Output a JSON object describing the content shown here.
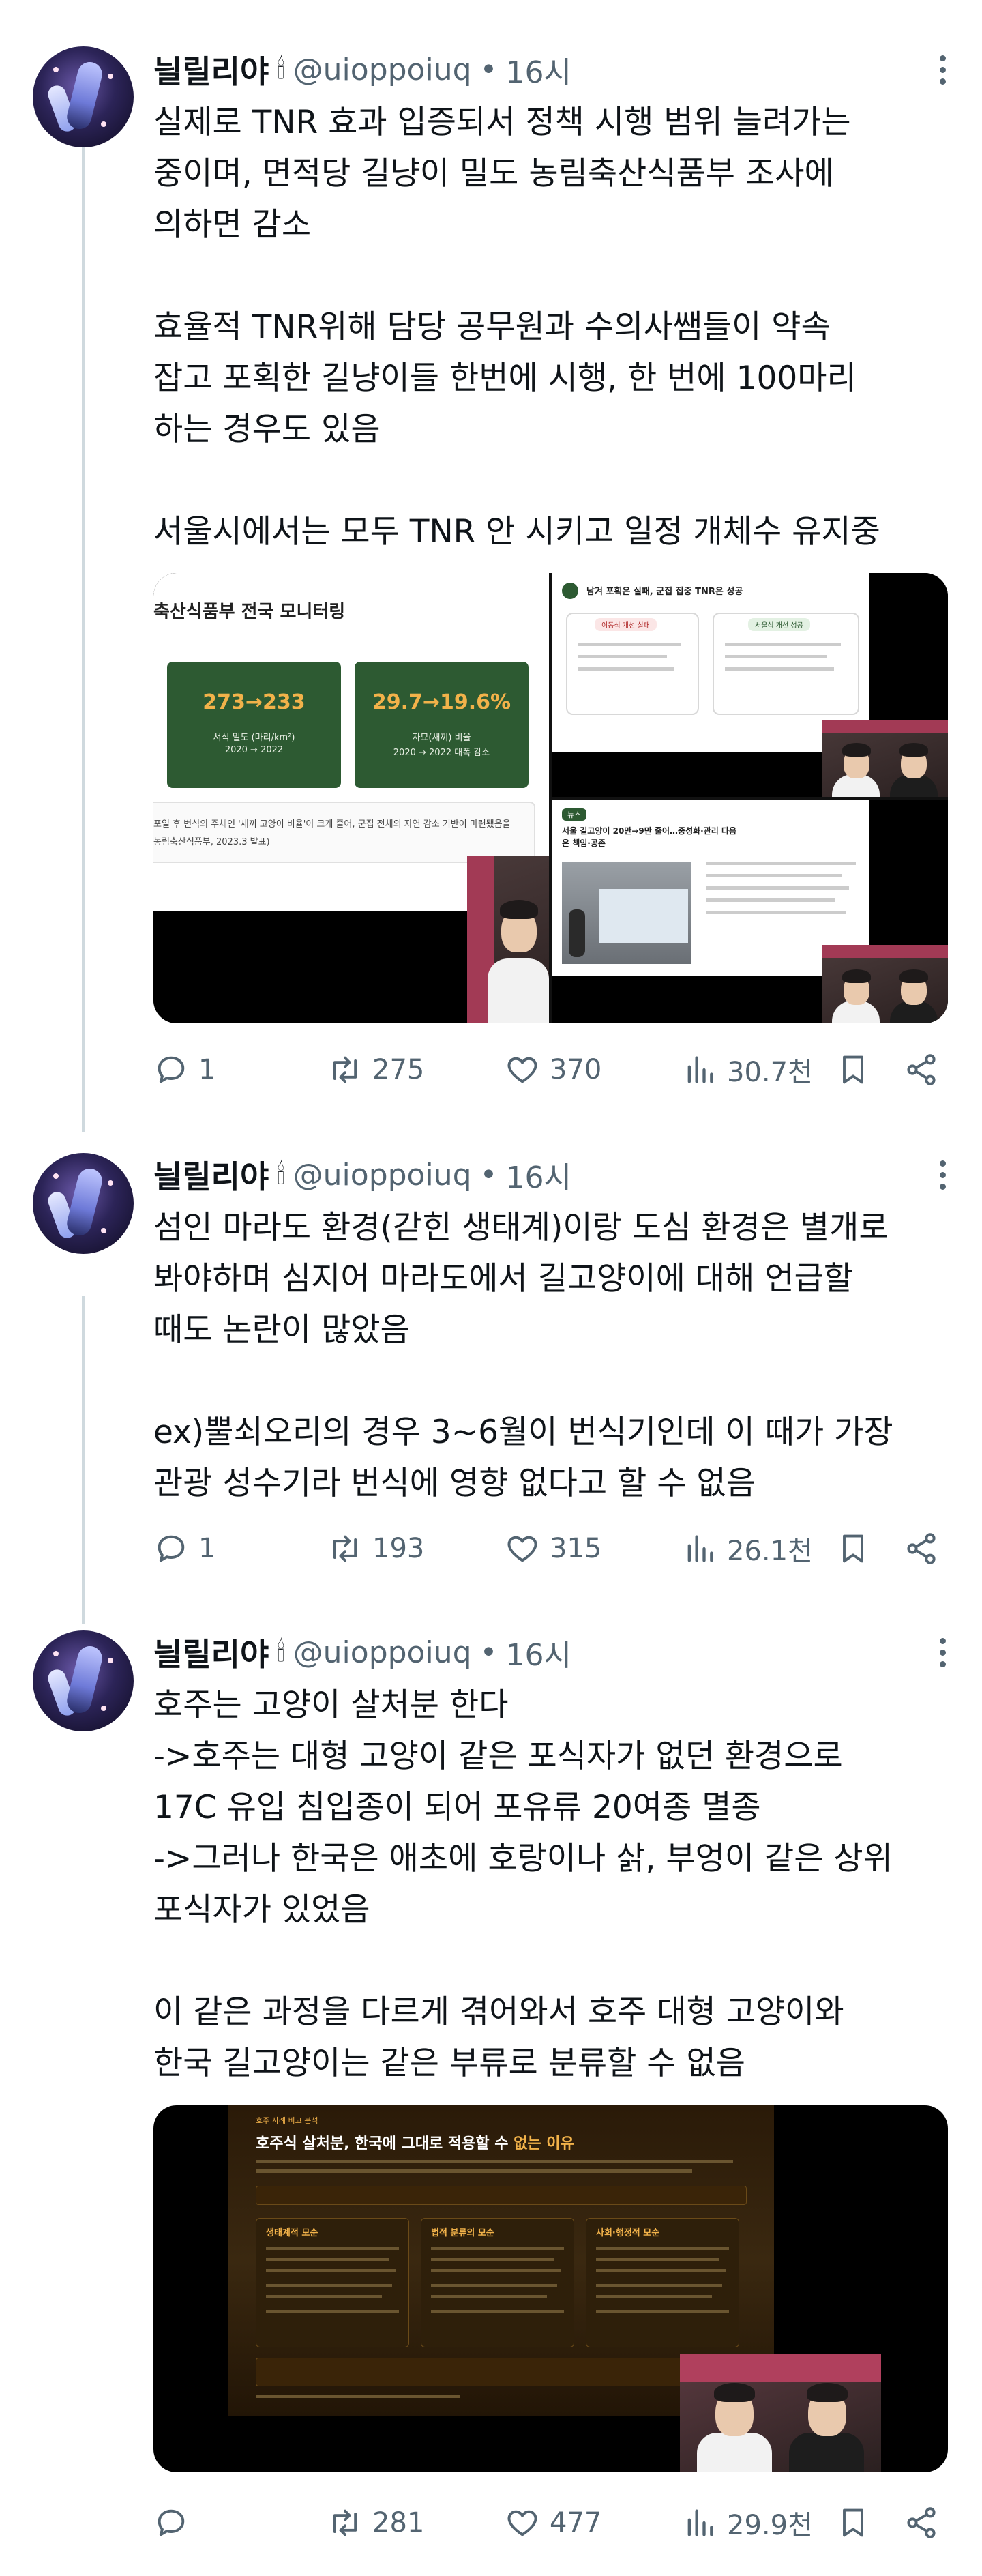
{
  "tweets": [
    {
      "name": "늴릴리야",
      "handle": "@uioppoiuq",
      "dot": "•",
      "time": "16시",
      "lines": [
        "실제로 TNR 효과 입증되서 정책 시행 범위 늘려가는",
        "중이며, 면적당 길냥이 밀도 농림축산식품부 조사에",
        "의하면 감소",
        "",
        "효율적 TNR위해 담당 공무원과 수의사쌤들이 약속",
        "잡고 포획한 길냥이들 한번에 시행, 한 번에 100마리",
        "하는 경우도 있음",
        "",
        "서울시에서는 모두 TNR 안 시키고 일정 개체수 유지중"
      ],
      "media": {
        "slide_title": "축산식품부 전국 모니터링",
        "card1_value": "273→233",
        "card1_label1": "서식 밀도 (마리/km²)",
        "card1_label2": "2020 → 2022",
        "card2_value": "29.7→19.6%",
        "card2_label1": "자묘(새끼) 비율",
        "card2_label2": "2020 → 2022 대폭 감소",
        "footnote1": "포일 후 번식의 주체인 '새끼 고양이 비율'이 크게 줄어, 군집 전체의 자연 감소 기반이 마련됐음을",
        "footnote2": "농림축산식품부, 2023.3 발표)",
        "panel_title": "남겨 포획은 실패, 군집 집중 TNR은 성공",
        "panel_left_head": "이동식 개선 실패",
        "panel_right_head": "서울식 개선 성공",
        "article_badge": "뉴스",
        "article_title": "서울 길고양이 20만→9만 줄어…중성화·관리 다음은 책임·공존"
      },
      "stats": {
        "reply": "1",
        "retweet": "275",
        "like": "370",
        "views": "30.7천"
      }
    },
    {
      "name": "늴릴리야",
      "handle": "@uioppoiuq",
      "dot": "•",
      "time": "16시",
      "lines": [
        "섬인 마라도 환경(갇힌 생태계)이랑 도심 환경은 별개로",
        "봐야하며 심지어 마라도에서 길고양이에 대해 언급할",
        "때도 논란이 많았음",
        "",
        "ex)뿔쇠오리의 경우 3~6월이 번식기인데 이 때가 가장",
        "관광 성수기라 번식에 영향 없다고 할 수 없음"
      ],
      "stats": {
        "reply": "1",
        "retweet": "193",
        "like": "315",
        "views": "26.1천"
      }
    },
    {
      "name": "늴릴리야",
      "handle": "@uioppoiuq",
      "dot": "•",
      "time": "16시",
      "lines": [
        "호주는 고양이 살처분 한다",
        "->호주는 대형 고양이 같은 포식자가 없던 환경으로",
        "17C 유입 침입종이 되어 포유류 20여종 멸종",
        "->그러나 한국은 애초에 호랑이나 삵, 부엉이 같은 상위",
        "포식자가 있었음",
        "",
        "이 같은 과정을 다르게 겪어와서 호주 대형 고양이와",
        "한국 길고양이는 같은 부류로 분류할 수 없음"
      ],
      "media": {
        "slide_tag": "호주 사례 비교 분석",
        "slide_title_a": "호주식 살처분, 한국에 그대로 적용할 수 ",
        "slide_title_b": "없는 이유",
        "col1": "생태계적 모순",
        "col2": "법적 분류의 모순",
        "col3": "사회·행정적 모순"
      },
      "stats": {
        "reply": "",
        "retweet": "281",
        "like": "477",
        "views": "29.9천"
      }
    }
  ],
  "colors": {
    "text": "#0f1419",
    "secondary": "#536471",
    "thread_line": "#cfd9de",
    "slide_green": "#2d5a32",
    "slide_gold": "#f2b24a"
  },
  "icons": [
    "reply-icon",
    "retweet-icon",
    "like-icon",
    "views-icon",
    "bookmark-icon",
    "share-icon",
    "more-icon",
    "candle-emoji"
  ]
}
